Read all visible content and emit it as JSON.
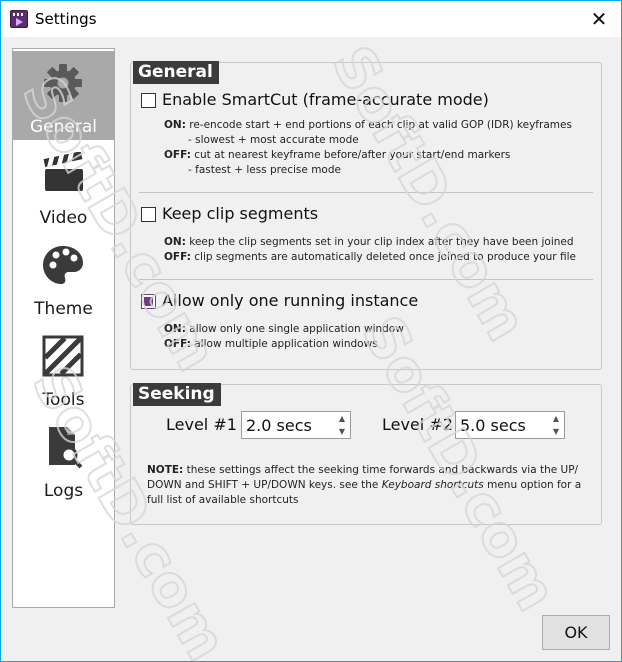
{
  "window": {
    "title": "Settings",
    "close_symbol": "✕"
  },
  "sidebar": {
    "items": [
      {
        "label": "General",
        "icon": "gear-icon",
        "active": true
      },
      {
        "label": "Video",
        "icon": "clapperboard-icon",
        "active": false
      },
      {
        "label": "Theme",
        "icon": "palette-icon",
        "active": false
      },
      {
        "label": "Tools",
        "icon": "tools-icon",
        "active": false
      },
      {
        "label": "Logs",
        "icon": "log-search-icon",
        "active": false
      }
    ]
  },
  "general": {
    "title": "General",
    "smartcut": {
      "label": "Enable SmartCut (frame-accurate mode)",
      "checked": false,
      "on_key": "ON:",
      "on_text": "re-encode start + end portions of each clip at valid GOP (IDR) keyframes",
      "on_sub": "- slowest + most accurate mode",
      "off_key": "OFF:",
      "off_text": "cut at nearest keyframe before/after your start/end markers",
      "off_sub": "- fastest + less precise mode"
    },
    "keep_segments": {
      "label": "Keep clip segments",
      "checked": false,
      "on_key": "ON:",
      "on_text": "keep the clip segments set in your clip index after they have been joined",
      "off_key": "OFF:",
      "off_text": "clip segments are automatically deleted once joined to produce your file"
    },
    "single_instance": {
      "label": "Allow only one running instance",
      "checked": true,
      "on_key": "ON:",
      "on_text": "allow only one single application window",
      "off_key": "OFF:",
      "off_text": "allow multiple application windows"
    }
  },
  "seeking": {
    "title": "Seeking",
    "level1_label": "Level #1",
    "level1_value": "2.0 secs",
    "level2_label": "Level #2",
    "level2_value": "5.0 secs",
    "note_key": "NOTE:",
    "note_text_1": "these settings affect the seeking time forwards and backwards via the UP/",
    "note_text_2": "DOWN and SHIFT + UP/DOWN keys. see the",
    "note_italic": "Keyboard shortcuts",
    "note_text_3": "menu option for a",
    "note_text_4": "full list of available shortcuts"
  },
  "footer": {
    "ok_label": "OK"
  },
  "watermark": {
    "text": "SoftD.com"
  },
  "colors": {
    "accent": "#6e3a80",
    "titlebar_border": "#00adef",
    "group_title_bg": "#3b3b3b",
    "active_nav_bg": "#a9a9a9"
  }
}
